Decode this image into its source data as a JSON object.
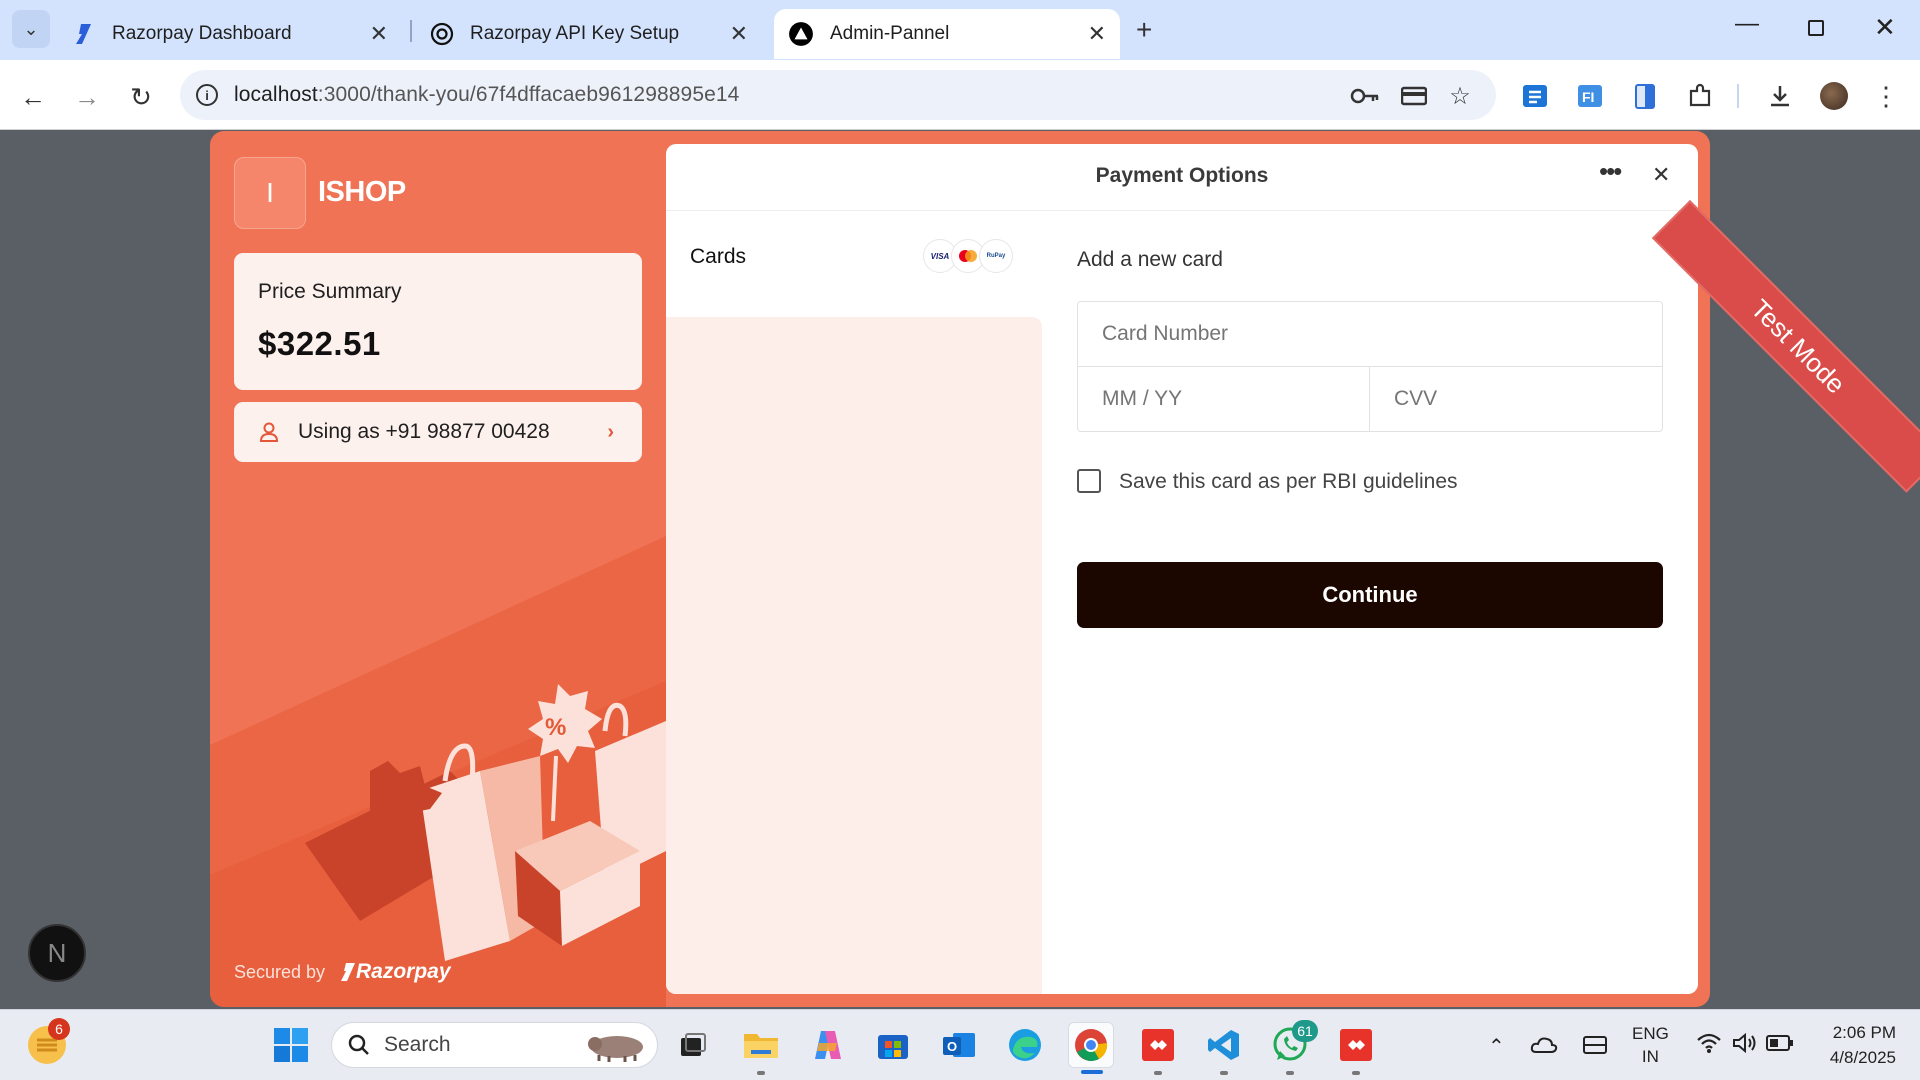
{
  "browser": {
    "tabs": [
      {
        "label": "Razorpay Dashboard",
        "icon": "razorpay-icon"
      },
      {
        "label": "Razorpay API Key Setup",
        "icon": "openai-icon"
      },
      {
        "label": "Admin-Pannel",
        "icon": "triangle-icon",
        "active": true
      }
    ],
    "url_host": "localhost",
    "url_rest": ":3000/thank-you/67f4dffacaeb961298895e14"
  },
  "checkout": {
    "brand_initial": "I",
    "brand_name": "ISHOP",
    "price_label": "Price Summary",
    "price_value": "$322.51",
    "user_label": "Using as +91 98877 00428",
    "secured_by": "Secured by",
    "razorpay_logo": "Razorpay",
    "modal_title": "Payment Options",
    "method_label": "Cards",
    "card_networks": [
      "VISA",
      "mastercard",
      "RuPay"
    ],
    "form_title": "Add a new card",
    "card_number_placeholder": "Card Number",
    "expiry_placeholder": "MM / YY",
    "cvv_placeholder": "CVV",
    "save_card_label": "Save this card as per RBI guidelines",
    "continue_label": "Continue",
    "test_mode": "Test Mode",
    "accent": "#f07356",
    "button_color": "#1c0600"
  },
  "taskbar": {
    "widget_badge": "6",
    "search_placeholder": "Search",
    "whatsapp_badge": "61",
    "lang_line1": "ENG",
    "lang_line2": "IN",
    "time": "2:06 PM",
    "date": "4/8/2025",
    "next_badge": "N"
  }
}
